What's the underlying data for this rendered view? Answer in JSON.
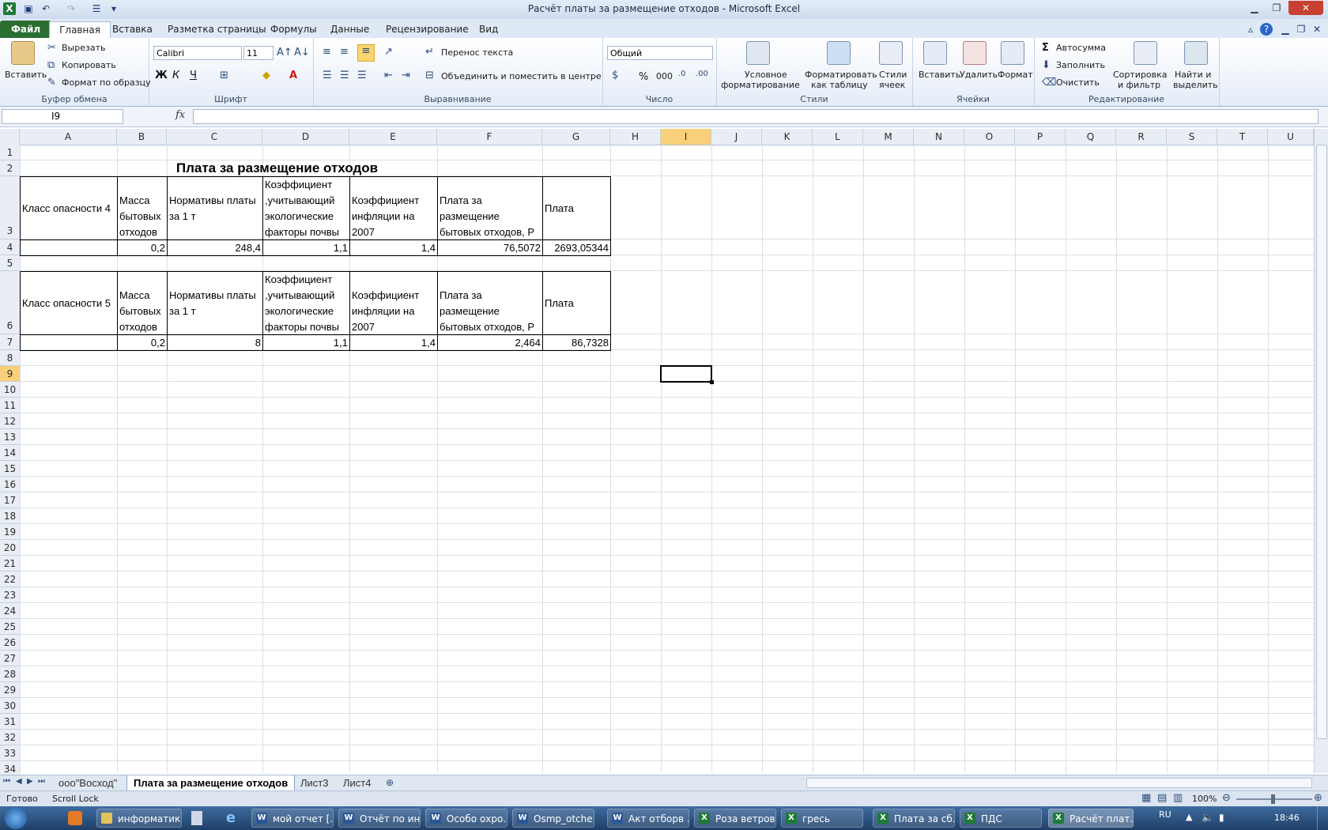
{
  "window": {
    "title": "Расчёт платы за размещение отходов  -  Microsoft Excel"
  },
  "tabs": [
    "Файл",
    "Главная",
    "Вставка",
    "Разметка страницы",
    "Формулы",
    "Данные",
    "Рецензирование",
    "Вид"
  ],
  "ribbon": {
    "clipboard": {
      "paste": "Вставить",
      "cut": "Вырезать",
      "copy": "Копировать",
      "format_painter": "Формат по образцу",
      "label": "Буфер обмена"
    },
    "font": {
      "name": "Calibri",
      "size": "11",
      "bold": "Ж",
      "italic": "К",
      "underline": "Ч",
      "label": "Шрифт"
    },
    "alignment": {
      "wrap": "Перенос текста",
      "merge": "Объединить и поместить в центре",
      "label": "Выравнивание"
    },
    "number": {
      "format": "Общий",
      "percent": "%",
      "thousands": "000",
      "label": "Число"
    },
    "styles": {
      "conditional": "Условное",
      "conditional2": "форматирование",
      "format_table": "Форматировать",
      "format_table2": "как таблицу",
      "cell_styles": "Стили",
      "cell_styles2": "ячеек",
      "label": "Стили"
    },
    "cells": {
      "insert": "Вставить",
      "delete": "Удалить",
      "format": "Формат",
      "label": "Ячейки"
    },
    "editing": {
      "autosum": "Автосумма",
      "fill": "Заполнить",
      "clear": "Очистить",
      "sort": "Сортировка",
      "sort2": "и фильтр",
      "find": "Найти и",
      "find2": "выделить",
      "label": "Редактирование"
    }
  },
  "formula_bar": {
    "name_box": "I9",
    "fx": "fx",
    "value": ""
  },
  "columns": [
    "A",
    "B",
    "C",
    "D",
    "E",
    "F",
    "G",
    "H",
    "I",
    "J",
    "K",
    "L",
    "M",
    "N",
    "O",
    "P",
    "Q",
    "R",
    "S",
    "T",
    "U"
  ],
  "sheet": {
    "title": "Плата за размещение отходов",
    "table1": {
      "headers": [
        "Класс опасности 4",
        "Масса бытовых отходов",
        "Нормативы платы за 1 т",
        "Коэффициент ,учитывающий экологические факторы почвы",
        "Коэффициент инфляции на 2007",
        "Плата за размещение бытовых отходов, Р",
        "Плата"
      ],
      "values": [
        "",
        "0,2",
        "248,4",
        "1,1",
        "1,4",
        "76,5072",
        "2693,05344"
      ]
    },
    "table2": {
      "headers": [
        "Класс опасности 5",
        "Масса бытовых отходов",
        "Нормативы платы за 1 т",
        "Коэффициент ,учитывающий экологические факторы почвы",
        "Коэффициент инфляции на 2007",
        "Плата за размещение бытовых отходов, Р",
        "Плата"
      ],
      "values": [
        "",
        "0,2",
        "8",
        "1,1",
        "1,4",
        "2,464",
        "86,7328"
      ]
    }
  },
  "sheet_tabs": [
    "ооо\"Восход\"",
    "Плата за размещение отходов",
    "Лист3",
    "Лист4"
  ],
  "status": {
    "ready": "Готово",
    "scroll_lock": "Scroll Lock",
    "zoom": "100%"
  },
  "taskbar": {
    "items": [
      "информатика",
      "мой отчет [...",
      "Отчёт по ин...",
      "Особо охро...",
      "Osmp_otche...",
      "Акт отборв ...",
      "Роза ветров",
      "гресь",
      "Плата за сб...",
      "ПДС",
      "Расчёт плат..."
    ],
    "lang": "RU",
    "time": "18:46"
  }
}
